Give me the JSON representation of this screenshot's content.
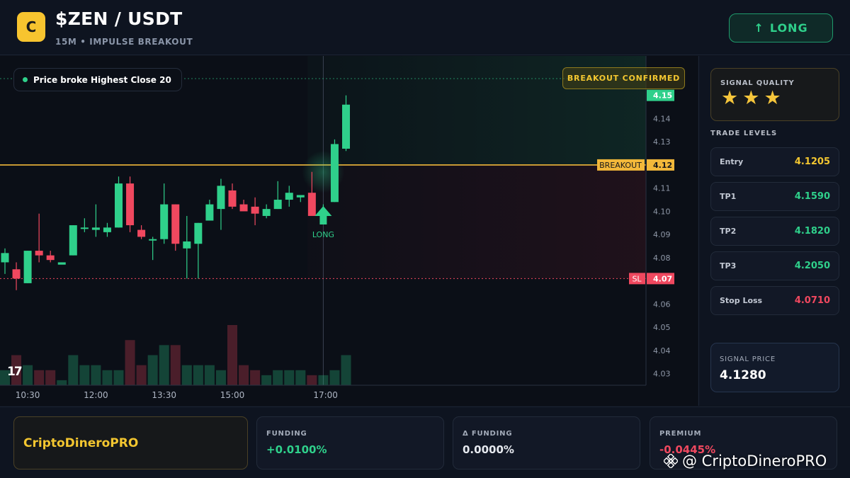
{
  "header": {
    "logo_letter": "C",
    "pair": "$ZEN / USDT",
    "subtitle": "15M • IMPULSE BREAKOUT",
    "direction_button": {
      "arrow": "↑",
      "label": "LONG"
    }
  },
  "chart_notes": {
    "pill": "Price broke Highest Close 20",
    "confirm_badge": "BREAKOUT CONFIRMED",
    "tv_logo": "17",
    "signal_marker": "LONG",
    "breakout_tag": "BREAKOUT",
    "sl_tag": "SL"
  },
  "chart_data": {
    "type": "candlestick",
    "ylim": [
      4.025,
      4.167
    ],
    "y_ticks": [
      "4.15",
      "4.14",
      "4.13",
      "4.12",
      "4.11",
      "4.10",
      "4.09",
      "4.08",
      "4.07",
      "4.06",
      "4.05",
      "4.04",
      "4.03"
    ],
    "x_ticks": [
      "10:30",
      "12:00",
      "13:30",
      "15:00",
      "17:00"
    ],
    "price_labels": {
      "last": "4.15",
      "breakout": "4.12",
      "sl": "4.07"
    },
    "levels": {
      "breakout": 4.12,
      "stop_loss": 4.071,
      "last": 4.15
    },
    "candles": [
      {
        "o": 4.078,
        "h": 4.084,
        "l": 4.073,
        "c": 4.082
      },
      {
        "o": 4.075,
        "h": 4.078,
        "l": 4.066,
        "c": 4.071
      },
      {
        "o": 4.069,
        "h": 4.083,
        "l": 4.069,
        "c": 4.083
      },
      {
        "o": 4.083,
        "h": 4.099,
        "l": 4.078,
        "c": 4.081
      },
      {
        "o": 4.081,
        "h": 4.083,
        "l": 4.078,
        "c": 4.079
      },
      {
        "o": 4.077,
        "h": 4.077,
        "l": 4.077,
        "c": 4.078
      },
      {
        "o": 4.081,
        "h": 4.094,
        "l": 4.081,
        "c": 4.094
      },
      {
        "o": 4.093,
        "h": 4.097,
        "l": 4.091,
        "c": 4.093
      },
      {
        "o": 4.092,
        "h": 4.103,
        "l": 4.089,
        "c": 4.093
      },
      {
        "o": 4.091,
        "h": 4.095,
        "l": 4.089,
        "c": 4.093
      },
      {
        "o": 4.093,
        "h": 4.115,
        "l": 4.093,
        "c": 4.112
      },
      {
        "o": 4.112,
        "h": 4.115,
        "l": 4.091,
        "c": 4.094
      },
      {
        "o": 4.092,
        "h": 4.094,
        "l": 4.088,
        "c": 4.089
      },
      {
        "o": 4.088,
        "h": 4.089,
        "l": 4.079,
        "c": 4.088
      },
      {
        "o": 4.088,
        "h": 4.112,
        "l": 4.086,
        "c": 4.103
      },
      {
        "o": 4.103,
        "h": 4.103,
        "l": 4.083,
        "c": 4.086
      },
      {
        "o": 4.084,
        "h": 4.098,
        "l": 4.071,
        "c": 4.087
      },
      {
        "o": 4.086,
        "h": 4.095,
        "l": 4.071,
        "c": 4.095
      },
      {
        "o": 4.096,
        "h": 4.105,
        "l": 4.096,
        "c": 4.103
      },
      {
        "o": 4.101,
        "h": 4.114,
        "l": 4.092,
        "c": 4.111
      },
      {
        "o": 4.109,
        "h": 4.112,
        "l": 4.101,
        "c": 4.102
      },
      {
        "o": 4.103,
        "h": 4.105,
        "l": 4.101,
        "c": 4.1
      },
      {
        "o": 4.102,
        "h": 4.106,
        "l": 4.094,
        "c": 4.099
      },
      {
        "o": 4.098,
        "h": 4.103,
        "l": 4.097,
        "c": 4.101
      },
      {
        "o": 4.101,
        "h": 4.113,
        "l": 4.101,
        "c": 4.105
      },
      {
        "o": 4.105,
        "h": 4.111,
        "l": 4.102,
        "c": 4.108
      },
      {
        "o": 4.106,
        "h": 4.107,
        "l": 4.104,
        "c": 4.107
      },
      {
        "o": 4.108,
        "h": 4.117,
        "l": 4.102,
        "c": 4.098
      },
      {
        "o": 4.099,
        "h": 4.103,
        "l": 4.097,
        "c": 4.1
      },
      {
        "o": 4.104,
        "h": 4.131,
        "l": 4.104,
        "c": 4.129
      },
      {
        "o": 4.127,
        "h": 4.15,
        "l": 4.126,
        "c": 4.146
      }
    ],
    "volumes": [
      3,
      6,
      4,
      3,
      3,
      1,
      6,
      4,
      4,
      3,
      3,
      9,
      4,
      6,
      8,
      8,
      4,
      4,
      4,
      3,
      12,
      4,
      3,
      2,
      3,
      3,
      3,
      2,
      2,
      3,
      6
    ],
    "colors": {
      "up": "#2fd08b",
      "down": "#f0485f",
      "breakout": "#f2b83a",
      "sl": "#f0485f"
    },
    "grid": false
  },
  "right_panel": {
    "quality_label": "SIGNAL QUALITY",
    "stars": [
      "★",
      "★",
      "★"
    ],
    "levels_heading": "TRADE LEVELS",
    "levels": [
      {
        "name": "Entry",
        "value": "4.1205",
        "color": "#f3c630"
      },
      {
        "name": "TP1",
        "value": "4.1590",
        "color": "#2fd08b"
      },
      {
        "name": "TP2",
        "value": "4.1820",
        "color": "#2fd08b"
      },
      {
        "name": "TP3",
        "value": "4.2050",
        "color": "#2fd08b"
      },
      {
        "name": "Stop Loss",
        "value": "4.0710",
        "color": "#f0485f"
      }
    ],
    "signal_price_label": "SIGNAL PRICE",
    "signal_price": "4.1280"
  },
  "footer": {
    "brand": "CriptoDineroPRO",
    "stats": [
      {
        "label": "FUNDING",
        "value": "+0.0100%",
        "color": "#2fd08b"
      },
      {
        "label": "Δ FUNDING",
        "value": "0.0000%",
        "color": "#e6e9ef"
      },
      {
        "label": "PREMIUM",
        "value": "-0.0445%",
        "color": "#f0485f"
      }
    ],
    "watermark": "@ CriptoDineroPRO"
  }
}
